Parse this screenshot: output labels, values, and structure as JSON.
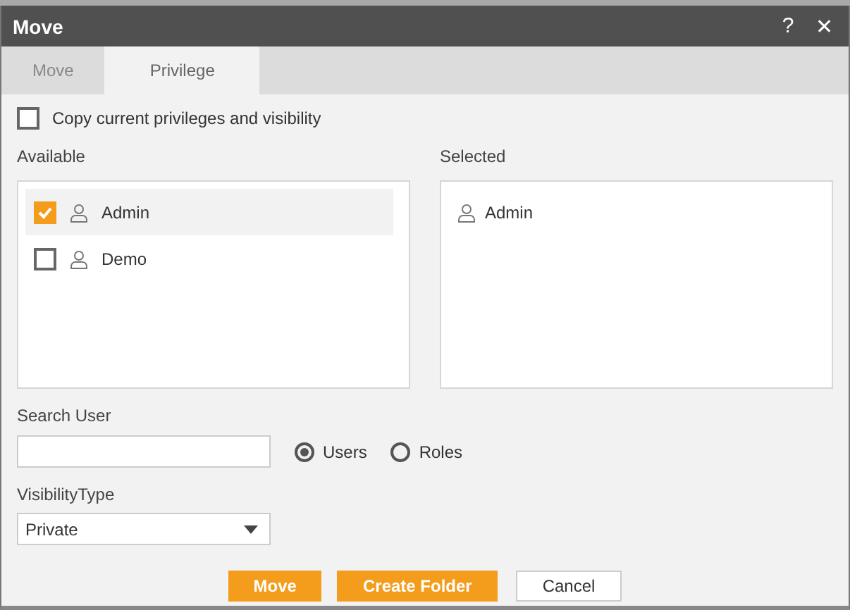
{
  "window": {
    "title": "Move",
    "help": "?",
    "close": "✕"
  },
  "tabs": [
    {
      "label": "Move",
      "selected": false
    },
    {
      "label": "Privilege",
      "selected": true
    }
  ],
  "copy_option": {
    "label": "Copy current privileges and visibility",
    "checked": false
  },
  "available": {
    "label": "Available",
    "items": [
      {
        "name": "Admin",
        "checked": true,
        "selected": true
      },
      {
        "name": "Demo",
        "checked": false,
        "selected": false
      }
    ]
  },
  "selected_list": {
    "label": "Selected",
    "items": [
      {
        "name": "Admin"
      }
    ]
  },
  "search": {
    "label": "Search User"
  },
  "search_type": [
    {
      "label": "Users",
      "selected": true
    },
    {
      "label": "Roles",
      "selected": false
    }
  ],
  "visibility": {
    "label": "VisibilityType",
    "value": "Private"
  },
  "buttons": [
    {
      "label": "Move",
      "kind": "primary"
    },
    {
      "label": "Create Folder",
      "kind": "primary"
    },
    {
      "label": "Cancel",
      "kind": "secondary"
    }
  ]
}
